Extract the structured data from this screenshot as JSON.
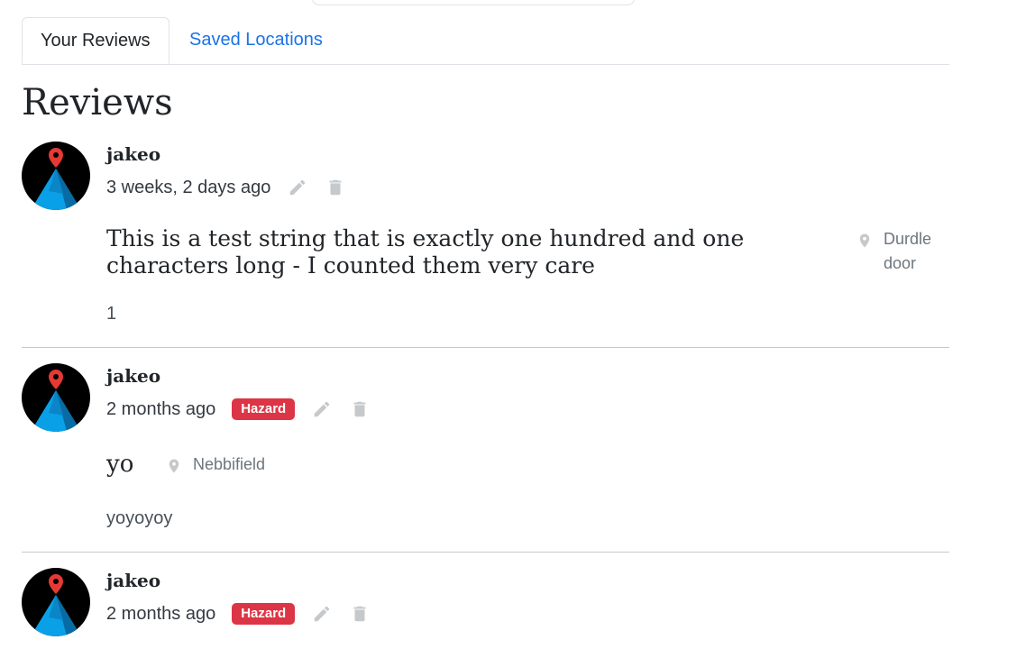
{
  "tabs": [
    {
      "label": "Your Reviews",
      "active": true
    },
    {
      "label": "Saved Locations",
      "active": false
    }
  ],
  "page_title": "Reviews",
  "colors": {
    "link": "#1a73e8",
    "hazard_badge": "#dc3545",
    "divider": "#c8c8c8",
    "icon_gray": "#c6c9cc"
  },
  "reviews": [
    {
      "author": "jakeo",
      "time": "3 weeks, 2 days ago",
      "badge": "",
      "title": "This is a test string that is exactly one hundred and one characters long - I counted them very care",
      "location": "Durdle door",
      "body": "1"
    },
    {
      "author": "jakeo",
      "time": "2 months ago",
      "badge": "Hazard",
      "title": "yo",
      "location": "Nebbifield",
      "body": "yoyoyoy"
    },
    {
      "author": "jakeo",
      "time": "2 months ago",
      "badge": "Hazard"
    }
  ],
  "icons": {
    "edit": "pencil-icon",
    "delete": "trash-icon",
    "location": "map-pin-icon",
    "avatar": "mountain-pin-avatar"
  }
}
